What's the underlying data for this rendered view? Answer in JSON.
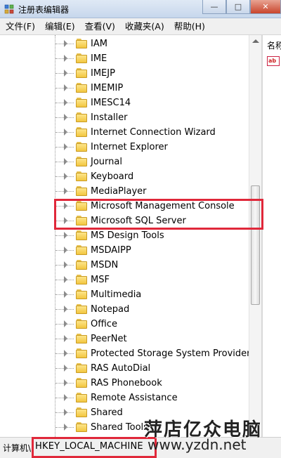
{
  "window": {
    "title": "注册表编辑器"
  },
  "menu": [
    "文件(F)",
    "编辑(E)",
    "查看(V)",
    "收藏夹(A)",
    "帮助(H)"
  ],
  "tree": {
    "items": [
      "IAM",
      "IME",
      "IMEJP",
      "IMEMIP",
      "IMESC14",
      "Installer",
      "Internet Connection Wizard",
      "Internet Explorer",
      "Journal",
      "Keyboard",
      "MediaPlayer",
      "Microsoft Management Console",
      "Microsoft SQL Server",
      "MS Design Tools",
      "MSDAIPP",
      "MSDN",
      "MSF",
      "Multimedia",
      "Notepad",
      "Office",
      "PeerNet",
      "Protected Storage System Provider",
      "RAS AutoDial",
      "RAS Phonebook",
      "Remote Assistance",
      "Shared",
      "Shared Tools"
    ],
    "highlighted": [
      "Microsoft Management Console",
      "Microsoft SQL Server"
    ]
  },
  "right_pane": {
    "column_header": "名称"
  },
  "status": {
    "label": "计算机\\",
    "path": "HKEY_LOCAL_MACHINE"
  },
  "watermark": {
    "name": "萍店亿众电脑",
    "url": "www.yzdn.net"
  },
  "colors": {
    "highlight": "#e0283a",
    "folder": "#f2c640",
    "menu_bg": "#f0f0f0"
  }
}
